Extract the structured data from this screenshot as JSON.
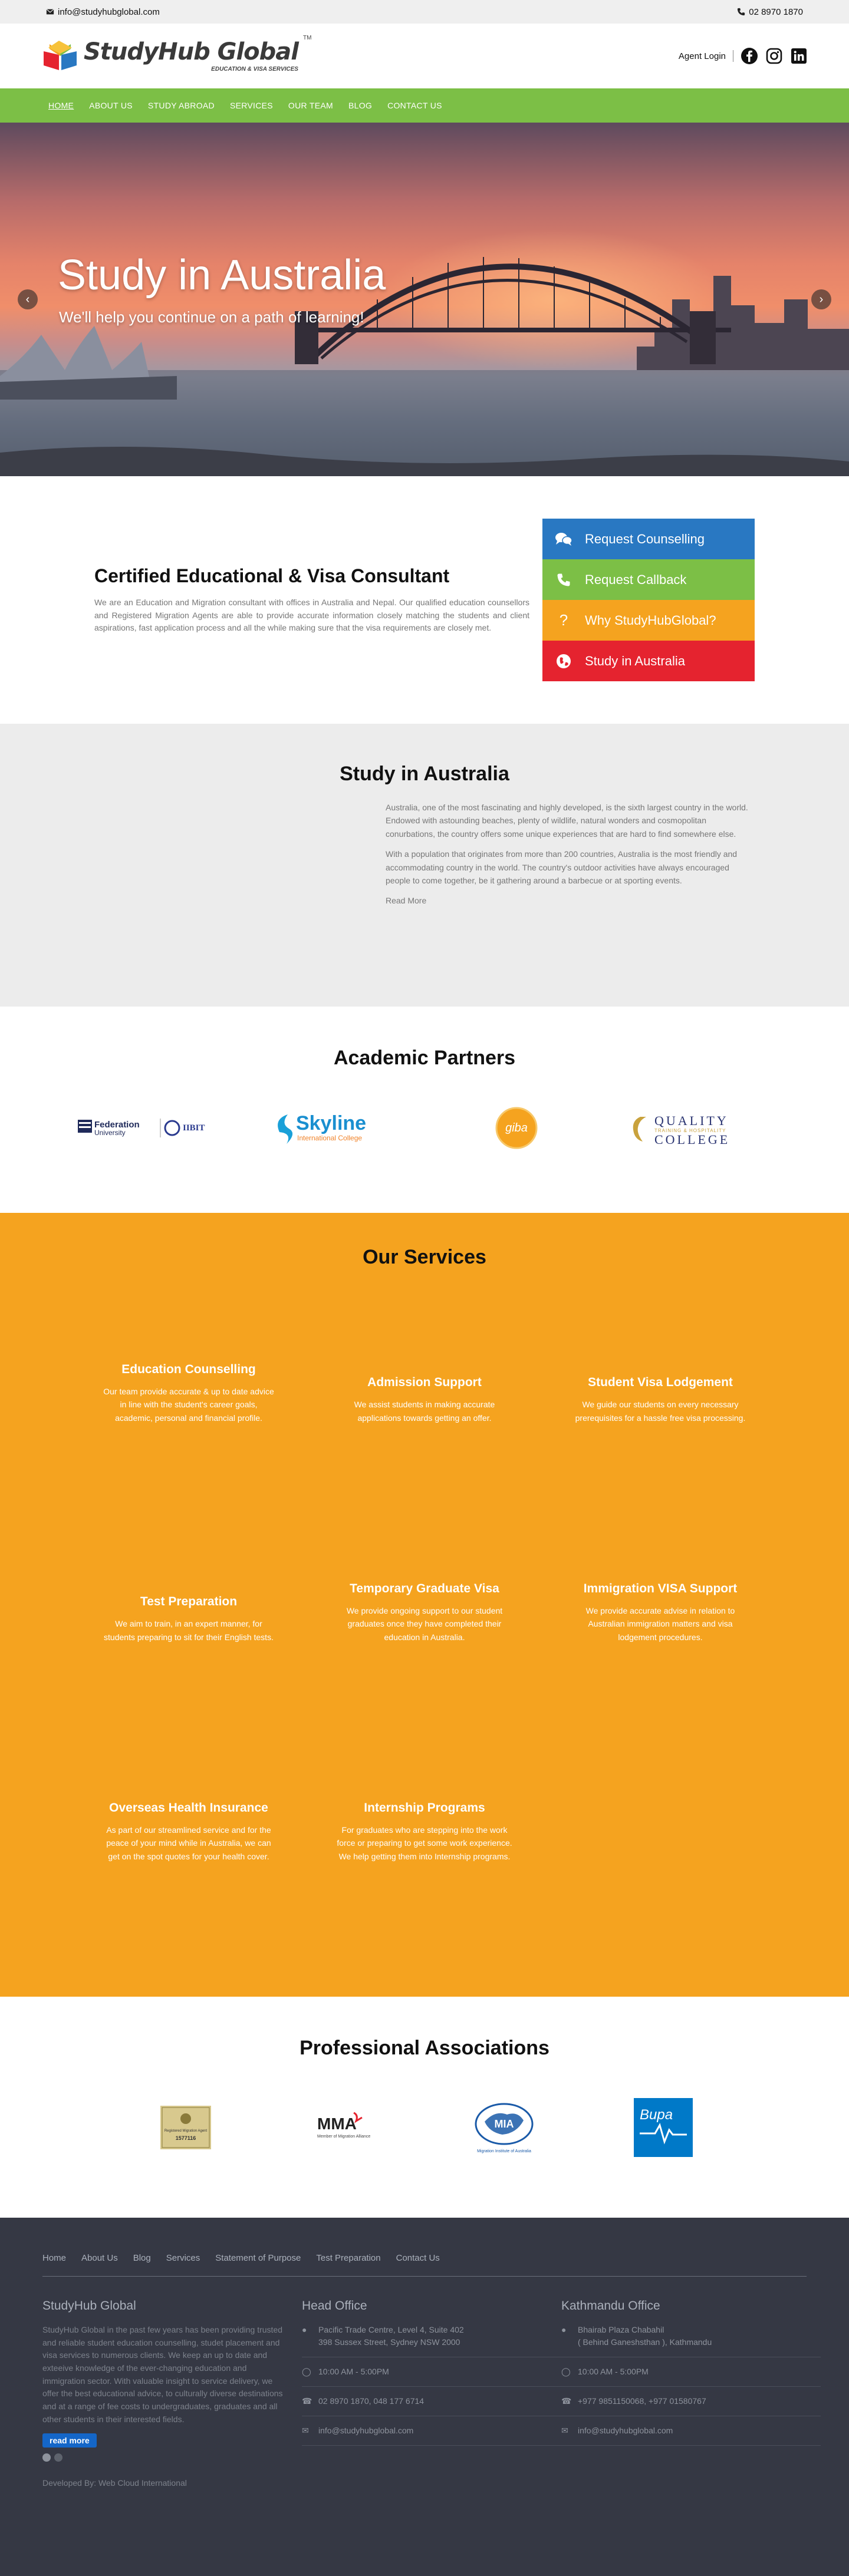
{
  "topbar": {
    "email": "info@studyhubglobal.com",
    "phone": "02 8970 1870"
  },
  "brand": {
    "name": "StudyHub Global",
    "tagline": "EDUCATION & VISA SERVICES",
    "tm": "TM"
  },
  "header": {
    "agent_login": "Agent Login"
  },
  "nav": [
    "HOME",
    "ABOUT US",
    "STUDY ABROAD",
    "SERVICES",
    "OUR TEAM",
    "BLOG",
    "CONTACT US"
  ],
  "hero": {
    "title": "Study in Australia",
    "subtitle": "We'll help you continue on a path of learning!"
  },
  "consultant": {
    "title": "Certified Educational & Visa Consultant",
    "text": "We are an Education and Migration consultant with offices in Australia and Nepal. Our qualified education counsellors and Registered Migration Agents are able to provide accurate information closely matching the students and client aspirations, fast application process and all the while making sure that the visa requirements are closely met."
  },
  "ctas": [
    {
      "label": "Request Counselling",
      "color": "#2978c2",
      "icon": "chat-icon"
    },
    {
      "label": "Request Callback",
      "color": "#7cbf46",
      "icon": "phone-icon"
    },
    {
      "label": "Why StudyHubGlobal?",
      "color": "#f5a31f",
      "icon": "question-icon"
    },
    {
      "label": "Study in Australia",
      "color": "#e5232f",
      "icon": "globe-icon"
    }
  ],
  "study": {
    "title": "Study in Australia",
    "p1": "Australia, one of the most fascinating and highly developed, is the sixth largest country in the world. Endowed with astounding beaches, plenty of wildlife, natural wonders and cosmopolitan conurbations, the country offers some unique experiences that are hard to find somewhere else.",
    "p2": "With a population that originates from more than 200 countries, Australia is the most friendly and accommodating country in the world. The country's outdoor activities have always encouraged people to come together, be it gathering around a barbecue or at sporting events.",
    "more": "Read More"
  },
  "partners": {
    "title": "Academic Partners",
    "federation": "Federation",
    "federation_sub": "University",
    "iibit": "IIBIT",
    "skyline": "Skyline",
    "skyline_sub": "International College",
    "giba": "giba",
    "quality": "QUALITY",
    "quality_tag": "TRAINING & HOSPITALITY",
    "college": "COLLEGE"
  },
  "services": {
    "title": "Our Services",
    "items": [
      {
        "title": "Education Counselling",
        "text": "Our team provide accurate & up to date advice in line with the student's career goals, academic, personal and financial profile."
      },
      {
        "title": "Admission Support",
        "text": "We assist students in making accurate applications towards getting an offer."
      },
      {
        "title": "Student Visa Lodgement",
        "text": "We guide our students on every necessary prerequisites for a hassle free visa processing."
      },
      {
        "title": "Test Preparation",
        "text": "We aim to train, in an expert manner, for students preparing to sit for their English tests."
      },
      {
        "title": "Temporary Graduate Visa",
        "text": "We provide ongoing support to our student graduates once they have completed their education in Australia."
      },
      {
        "title": "Immigration VISA Support",
        "text": "We provide accurate advise in relation to Australian immigration matters and visa lodgement procedures."
      },
      {
        "title": "Overseas Health Insurance",
        "text": "As part of our streamlined service and for the peace of your mind while in Australia, we can get on the spot quotes for your health cover."
      },
      {
        "title": "Internship Programs",
        "text": "For graduates who are stepping into the work force or preparing to get some work experience. We help getting them into Internship programs."
      }
    ]
  },
  "associations": {
    "title": "Professional Associations",
    "marn": "Registered Migration Agent",
    "marn_no": "1577116",
    "mma": "MMA",
    "mma_sub": "Member of Migration Alliance",
    "mia": "MIA",
    "mia_sub": "Migration Institute of Australia",
    "bupa": "Bupa"
  },
  "footer": {
    "links": [
      "Home",
      "About Us",
      "Blog",
      "Services",
      "Statement of Purpose",
      "Test Preparation",
      "Contact Us"
    ],
    "about_title": "StudyHub Global",
    "about_text": "StudyHub Global in the past few years has been providing trusted and reliable student education counselling, studet placement and visa services to numerous clients. We keep an up to date and exteeive knowledge of the ever-changing education and immigration sector. With valuable insight to service delivery, we offer the best educational advice, to culturally diverse destinations and at a range of fee costs to undergraduates, graduates and all other students in their interested fields.",
    "read_more": "read more",
    "head_title": "Head Office",
    "head_addr": "Pacific Trade Centre, Level 4, Suite 402\n398 Sussex Street, Sydney NSW 2000",
    "head_hours": "10:00 AM - 5:00PM",
    "head_phone": "02 8970 1870, 048 177 6714",
    "head_email": "info@studyhubglobal.com",
    "ktm_title": "Kathmandu Office",
    "ktm_addr": "Bhairab Plaza Chabahil\n( Behind Ganeshsthan ), Kathmandu",
    "ktm_hours": "10:00 AM - 5:00PM",
    "ktm_phone": "+977 9851150068, +977 01580767",
    "ktm_email": "info@studyhubglobal.com",
    "dev": "Developed By: Web Cloud International"
  }
}
